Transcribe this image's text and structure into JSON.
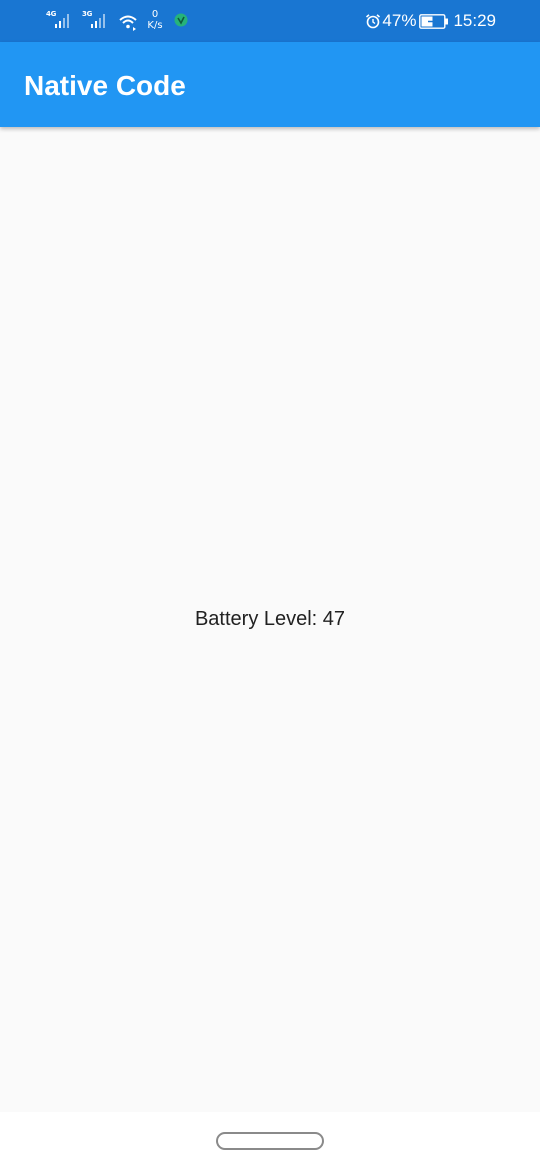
{
  "status_bar": {
    "network_1": "4G",
    "network_2": "3G",
    "speed_value": "0",
    "speed_unit": "K/s",
    "battery_percent": "47%",
    "time": "15:29"
  },
  "app_bar": {
    "title": "Native Code"
  },
  "main": {
    "battery_text": "Battery Level: 47"
  },
  "colors": {
    "status_bar_bg": "#1976d2",
    "app_bar_bg": "#2196f3",
    "page_bg": "#fafafa"
  }
}
